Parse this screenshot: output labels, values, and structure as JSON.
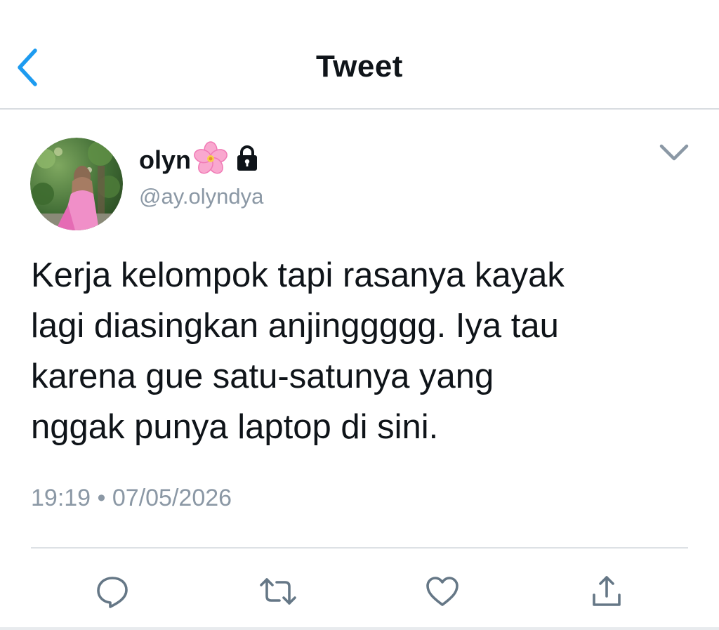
{
  "header": {
    "title": "Tweet",
    "back_icon": "chevron-left-icon"
  },
  "tweet": {
    "user_name": "olyn",
    "name_emoji": "cherry-blossom-icon",
    "protected_icon": "lock-icon",
    "handle": "@ay.olyndya",
    "text": "Kerja kelompok tapi rasanya kayak\nlagi diasingkan anjinggggg. Iya tau\nkarena gue satu-satunya yang\nnggak punya laptop di sini.",
    "timestamp": "19:19 • 07/05/2026"
  },
  "actions": {
    "reply_icon": "reply-icon",
    "retweet_icon": "retweet-icon",
    "like_icon": "heart-icon",
    "share_icon": "share-icon"
  },
  "colors": {
    "accent": "#1d9bf0",
    "text_primary": "#0f1419",
    "text_secondary": "#8b98a5",
    "icon_gray": "#657786",
    "divider": "#d8dce0"
  }
}
